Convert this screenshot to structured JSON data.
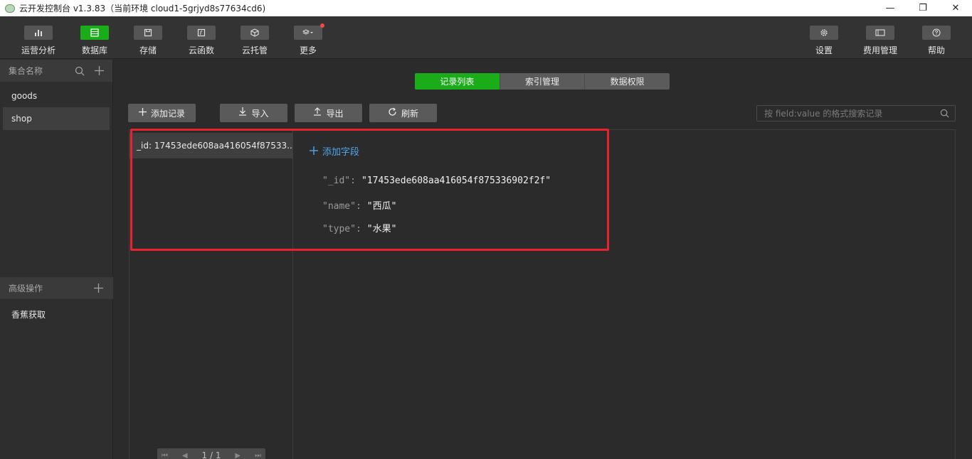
{
  "window": {
    "title": "云开发控制台 v1.3.83（当前环境 cloud1-5grjyd8s77634cd6)",
    "controls": {
      "minimize": "—",
      "restore": "❐",
      "close": "✕"
    }
  },
  "toolbar": {
    "left": [
      {
        "label": "运营分析",
        "icon": "bar-chart-icon",
        "active": false
      },
      {
        "label": "数据库",
        "icon": "database-icon",
        "active": true
      },
      {
        "label": "存储",
        "icon": "storage-icon",
        "active": false
      },
      {
        "label": "云函数",
        "icon": "function-icon",
        "active": false
      },
      {
        "label": "云托管",
        "icon": "cube-icon",
        "active": false
      },
      {
        "label": "更多",
        "icon": "layers-icon",
        "active": false,
        "badge": true
      }
    ],
    "right": [
      {
        "label": "设置",
        "icon": "gear-icon"
      },
      {
        "label": "费用管理",
        "icon": "card-icon"
      },
      {
        "label": "帮助",
        "icon": "help-icon"
      }
    ]
  },
  "sidebar": {
    "header": "集合名称",
    "items": [
      {
        "label": "goods",
        "selected": false
      },
      {
        "label": "shop",
        "selected": true
      }
    ],
    "advanced_header": "高级操作",
    "advanced_items": [
      "香蕉获取"
    ]
  },
  "tabs": [
    {
      "label": "记录列表",
      "active": true
    },
    {
      "label": "索引管理",
      "active": false
    },
    {
      "label": "数据权限",
      "active": false
    }
  ],
  "actions": {
    "add_record": "添加记录",
    "import": "导入",
    "export": "导出",
    "refresh": "刷新"
  },
  "search": {
    "placeholder": "按 field:value 的格式搜索记录"
  },
  "records": {
    "list": [
      "_id: 17453ede608aa416054f87533..."
    ],
    "pager": "1 / 1"
  },
  "document": {
    "add_field": "添加字段",
    "fields": [
      {
        "key": "\"_id\"",
        "value": "\"17453ede608aa416054f875336902f2f\""
      },
      {
        "key": "\"name\"",
        "value": "\"西瓜\""
      },
      {
        "key": "\"type\"",
        "value": "\"水果\""
      }
    ]
  },
  "colors": {
    "accent": "#1aad19",
    "link": "#4fa6f0",
    "highlight": "#e8222e"
  }
}
